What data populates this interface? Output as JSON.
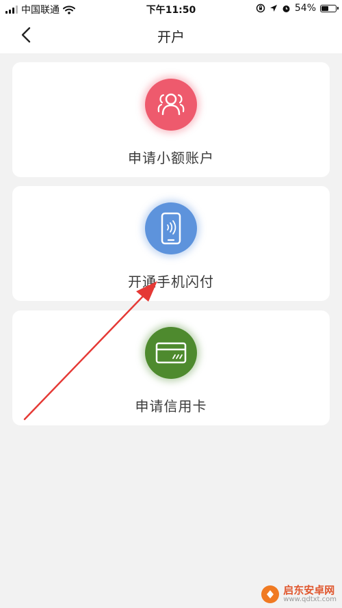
{
  "status_bar": {
    "carrier": "中国联通",
    "time": "下午11:50",
    "battery": "54%",
    "battery_level": 0.54
  },
  "nav": {
    "title": "开户"
  },
  "cards": [
    {
      "label": "申请小额账户",
      "icon": "users-icon",
      "color": "#ee5a6d"
    },
    {
      "label": "开通手机闪付",
      "icon": "phone-nfc-icon",
      "color": "#5d93dc"
    },
    {
      "label": "申请信用卡",
      "icon": "credit-card-icon",
      "color": "#4e8a2e"
    }
  ],
  "annotation": {
    "arrow_color": "#e53935"
  },
  "watermark": {
    "title": "启东安卓网",
    "url": "www.qdtxt.com"
  }
}
